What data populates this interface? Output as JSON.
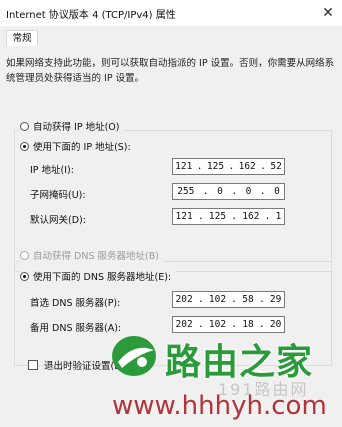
{
  "window": {
    "title": "Internet 协议版本 4 (TCP/IPv4) 属性",
    "close_glyph": "✕"
  },
  "tabs": [
    {
      "label": "常规"
    }
  ],
  "description": "如果网络支持此功能，则可以获取自动指派的 IP 设置。否则，你需要从网络系统管理员处获得适当的 IP 设置。",
  "ip_section": {
    "auto_radio": {
      "label": "自动获得 IP 地址(O)",
      "checked": false
    },
    "manual_radio": {
      "label": "使用下面的 IP 地址(S):",
      "checked": true
    },
    "fields": [
      {
        "label": "IP 地址(I):",
        "octets": [
          "121",
          "125",
          "162",
          "52"
        ]
      },
      {
        "label": "子网掩码(U):",
        "octets": [
          "255",
          "0",
          "0",
          "0"
        ]
      },
      {
        "label": "默认网关(D):",
        "octets": [
          "121",
          "125",
          "162",
          "1"
        ]
      }
    ]
  },
  "dns_section": {
    "auto_radio": {
      "label": "自动获得 DNS 服务器地址(B)",
      "checked": false,
      "disabled": true
    },
    "manual_radio": {
      "label": "使用下面的 DNS 服务器地址(E):",
      "checked": true
    },
    "fields": [
      {
        "label": "首选 DNS 服务器(P):",
        "octets": [
          "202",
          "102",
          "58",
          "29"
        ]
      },
      {
        "label": "备用 DNS 服务器(A):",
        "octets": [
          "202",
          "102",
          "18",
          "20"
        ]
      }
    ]
  },
  "validate_checkbox": {
    "label": "退出时验证设置(L)",
    "checked": false
  },
  "watermark": {
    "brand": "路由之家",
    "sub": "191路由网",
    "url": "www.hhhyh.com",
    "colors": {
      "brand": "#2a9a3a",
      "url": "#b0343a"
    }
  }
}
